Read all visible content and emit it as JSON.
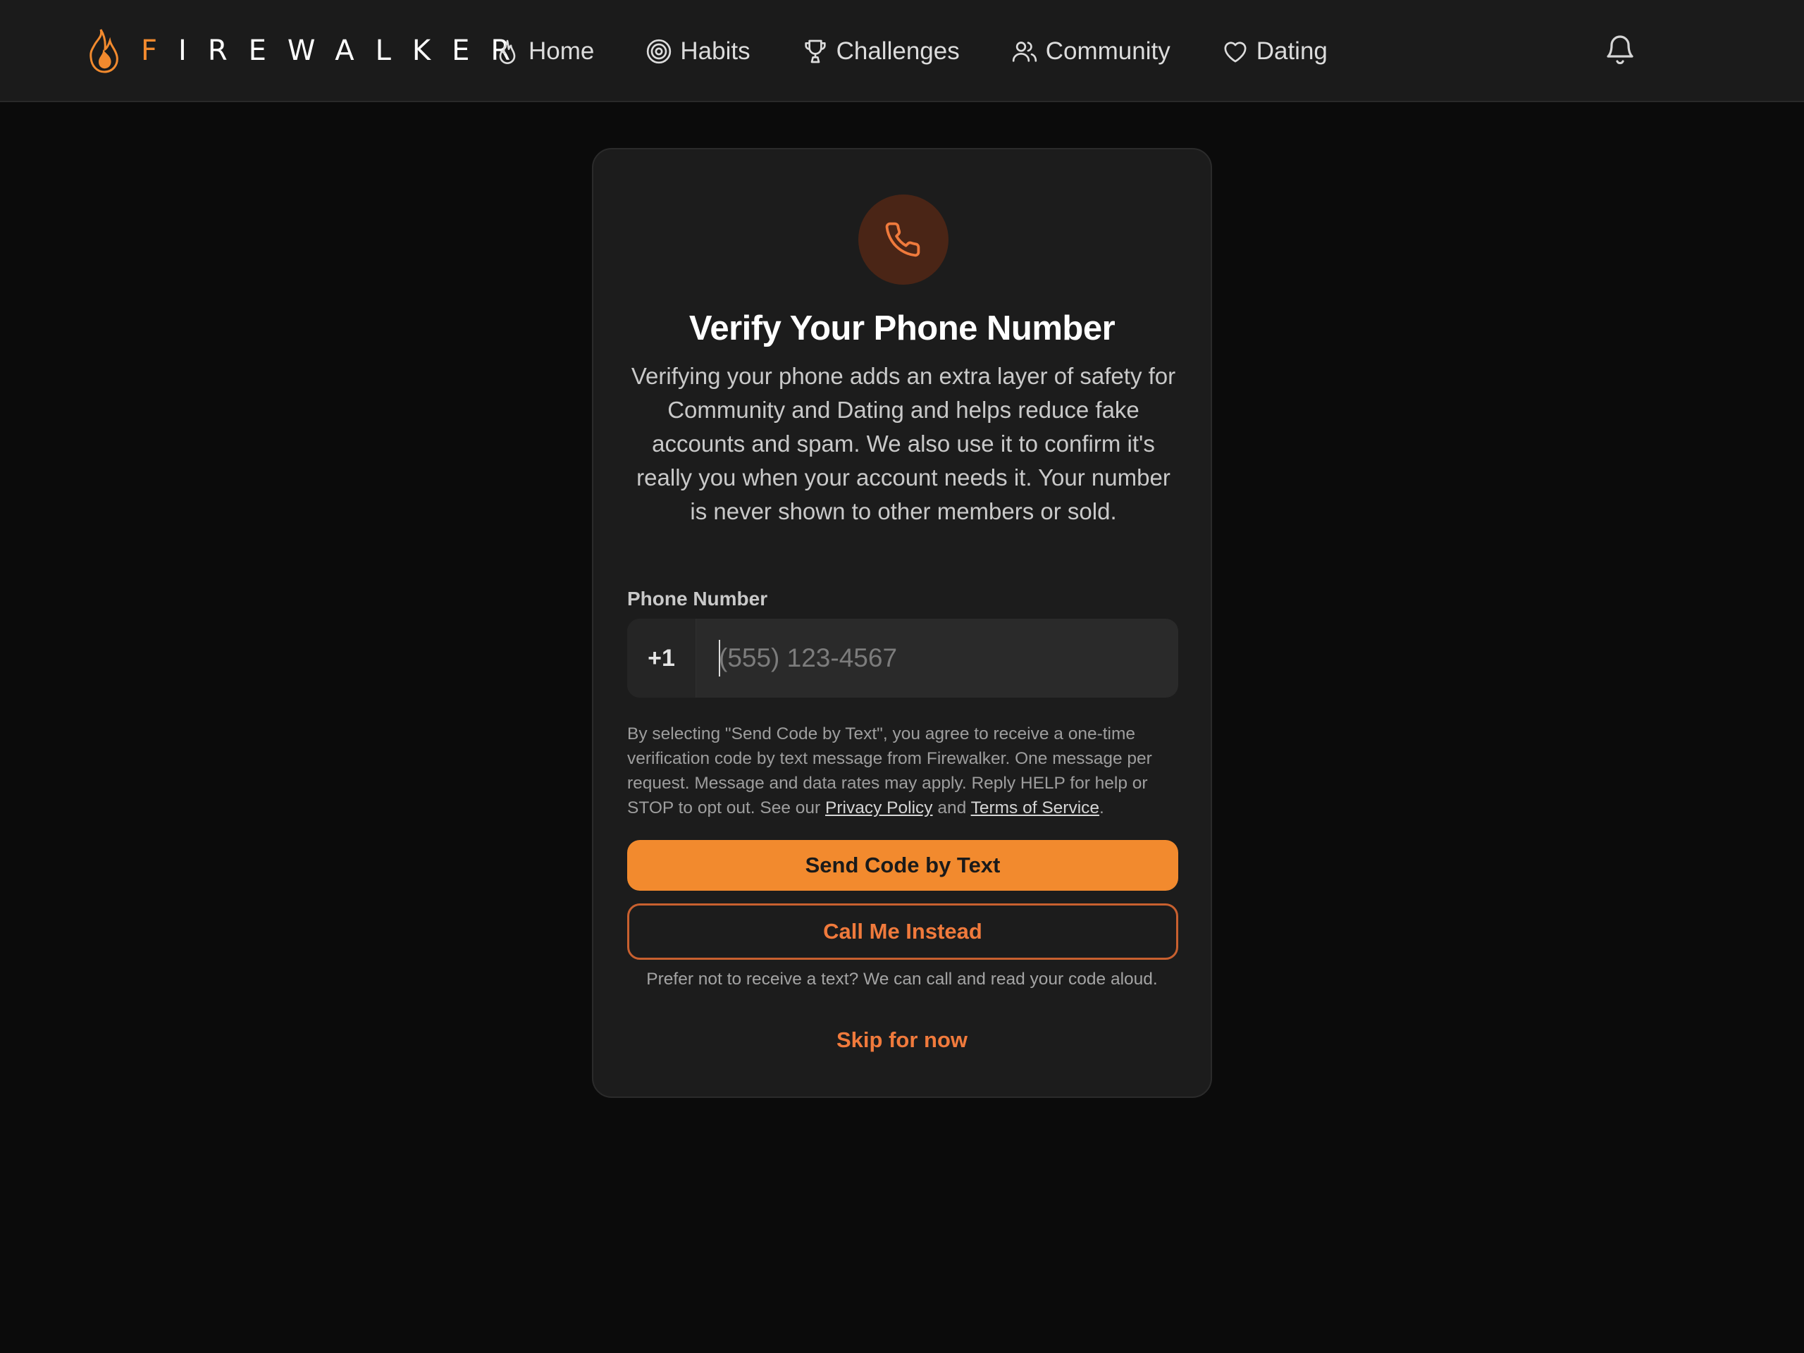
{
  "brand": {
    "name_first": "F",
    "name_rest": "IREWALKER",
    "accent_color": "#f28a2e"
  },
  "nav": {
    "items": [
      {
        "label": "Home",
        "icon": "flame-icon"
      },
      {
        "label": "Habits",
        "icon": "target-icon"
      },
      {
        "label": "Challenges",
        "icon": "trophy-icon"
      },
      {
        "label": "Community",
        "icon": "users-icon"
      },
      {
        "label": "Dating",
        "icon": "heart-icon"
      }
    ],
    "notifications_icon": "bell-icon"
  },
  "verify": {
    "icon": "phone-icon",
    "title": "Verify Your Phone Number",
    "description": "Verifying your phone adds an extra layer of safety for Community and Dating and helps reduce fake accounts and spam. We also use it to confirm it's really you when your account needs it. Your number is never shown to other members or sold.",
    "phone_label": "Phone Number",
    "country_code": "+1",
    "phone_value": "",
    "phone_placeholder": "(555) 123-4567",
    "consent_text": "By selecting \"Send Code by Text\", you agree to receive a one-time verification code by text message from Firewalker. One message per request. Message and data rates may apply. Reply HELP for help or STOP to opt out. See our ",
    "privacy_link": "Privacy Policy",
    "consent_and": " and ",
    "terms_link": "Terms of Service",
    "consent_end": ".",
    "send_button": "Send Code by Text",
    "call_button": "Call Me Instead",
    "call_note": "Prefer not to receive a text? We can call and read your code aloud.",
    "skip_link": "Skip for now"
  }
}
